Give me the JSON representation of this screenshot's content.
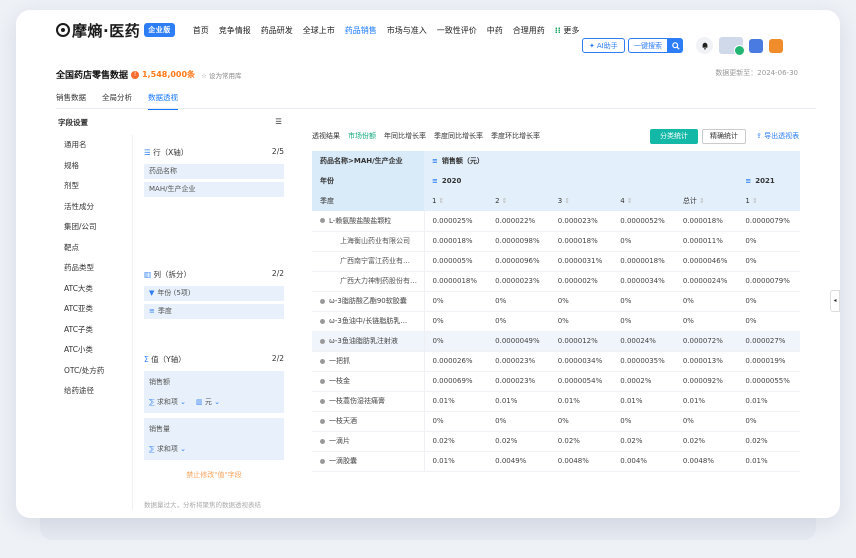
{
  "nav": {
    "logo": "摩熵·医药",
    "enterprise_badge": "企业版",
    "menu": [
      "首页",
      "竞争情报",
      "药品研发",
      "全球上市",
      "药品销售",
      "市场与准入",
      "一致性评价",
      "中药",
      "合理用药",
      "更多"
    ],
    "active_menu": "药品销售",
    "ai_label": "AI助手",
    "search_label": "一键搜索"
  },
  "page": {
    "title": "全国药店零售数据",
    "count": "1,548,000条",
    "favorite": "☆ 设为常用库",
    "update": "数据更新至：2024-06-30"
  },
  "tabs": [
    "销售数据",
    "全局分析",
    "数据透视"
  ],
  "active_tab": "数据透视",
  "left": {
    "header": "字段设置",
    "fields": [
      "通用名",
      "规格",
      "剂型",
      "活性成分",
      "集团/公司",
      "靶点",
      "药品类型",
      "ATC大类",
      "ATC亚类",
      "ATC子类",
      "ATC小类",
      "OTC/处方药",
      "给药途径"
    ],
    "rows_title": "行（X轴）",
    "rows_count": "2/5",
    "rows_items": [
      "药品名称",
      "MAH/生产企业"
    ],
    "cols_title": "列（拆分）",
    "cols_count": "2/2",
    "cols_items": [
      "年份 (5项)",
      "季度"
    ],
    "vals_title": "值（Y轴）",
    "vals_count": "2/2",
    "val1_name": "销售额",
    "val1_agg": "求和项",
    "val1_unit": "元",
    "val2_name": "销售量",
    "val2_agg": "求和项",
    "warning": "禁止修改\"值\"字段",
    "note": "数据量过大，分析将聚焦的数据透视表结"
  },
  "right": {
    "view_tabs": [
      "透视结果",
      "市场份额",
      "年同比增长率",
      "季度同比增长率",
      "季度环比增长率"
    ],
    "active_view": "市场份额",
    "btn_category": "分类统计",
    "btn_precise": "精确统计",
    "export": "导出透视表",
    "header1": {
      "left": "药品名称>MAH/生产企业",
      "right": "销售额（元）"
    },
    "header2": {
      "left": "年份",
      "year": "2020",
      "year2": "2021"
    },
    "header3": {
      "left": "季度",
      "cols": [
        "1",
        "2",
        "3",
        "4",
        "总计",
        "1"
      ]
    },
    "rows": [
      {
        "name": "L-赖氨酸盐酸盐颗粒",
        "child": false,
        "hl": false,
        "v": [
          "0.000025%",
          "0.000022%",
          "0.000023%",
          "0.0000052%",
          "0.000018%",
          "0.0000079%"
        ]
      },
      {
        "name": "上海衡山药业有限公司",
        "child": true,
        "hl": false,
        "v": [
          "0.000018%",
          "0.0000098%",
          "0.000018%",
          "0%",
          "0.000011%",
          "0%"
        ]
      },
      {
        "name": "广西南宁富江药业有…",
        "child": true,
        "hl": false,
        "v": [
          "0.000005%",
          "0.0000096%",
          "0.0000031%",
          "0.0000018%",
          "0.0000046%",
          "0%"
        ]
      },
      {
        "name": "广西大力神制药股份有…",
        "child": true,
        "hl": false,
        "v": [
          "0.0000018%",
          "0.0000023%",
          "0.000002%",
          "0.0000034%",
          "0.0000024%",
          "0.0000079%"
        ]
      },
      {
        "name": "ω-3脂肪酸乙酯90软胶囊",
        "child": false,
        "hl": false,
        "v": [
          "0%",
          "0%",
          "0%",
          "0%",
          "0%",
          "0%"
        ]
      },
      {
        "name": "ω-3鱼油中/长链脂肪乳…",
        "child": false,
        "hl": false,
        "v": [
          "0%",
          "0%",
          "0%",
          "0%",
          "0%",
          "0%"
        ]
      },
      {
        "name": "ω-3鱼油脂肪乳注射液",
        "child": false,
        "hl": true,
        "v": [
          "0%",
          "0.0000049%",
          "0.000012%",
          "0.00024%",
          "0.000072%",
          "0.000027%"
        ]
      },
      {
        "name": "一把抓",
        "child": false,
        "hl": false,
        "v": [
          "0.000026%",
          "0.000023%",
          "0.0000034%",
          "0.0000035%",
          "0.000013%",
          "0.000019%"
        ]
      },
      {
        "name": "一枝金",
        "child": false,
        "hl": false,
        "v": [
          "0.000069%",
          "0.000023%",
          "0.0000054%",
          "0.0002%",
          "0.000092%",
          "0.0000055%"
        ]
      },
      {
        "name": "一枝蒿伤湿祛痛膏",
        "child": false,
        "hl": false,
        "v": [
          "0.01%",
          "0.01%",
          "0.01%",
          "0.01%",
          "0.01%",
          "0.01%"
        ]
      },
      {
        "name": "一枝天酒",
        "child": false,
        "hl": false,
        "v": [
          "0%",
          "0%",
          "0%",
          "0%",
          "0%",
          "0%"
        ]
      },
      {
        "name": "一滴片",
        "child": false,
        "hl": false,
        "v": [
          "0.02%",
          "0.02%",
          "0.02%",
          "0.02%",
          "0.02%",
          "0.02%"
        ]
      },
      {
        "name": "一滴胶囊",
        "child": false,
        "hl": false,
        "v": [
          "0.01%",
          "0.0049%",
          "0.0048%",
          "0.004%",
          "0.0048%",
          "0.01%"
        ]
      }
    ]
  },
  "colors": {
    "accent": "#1677ff",
    "green": "#14b8a6",
    "header_bg": "#e3f0fb"
  }
}
